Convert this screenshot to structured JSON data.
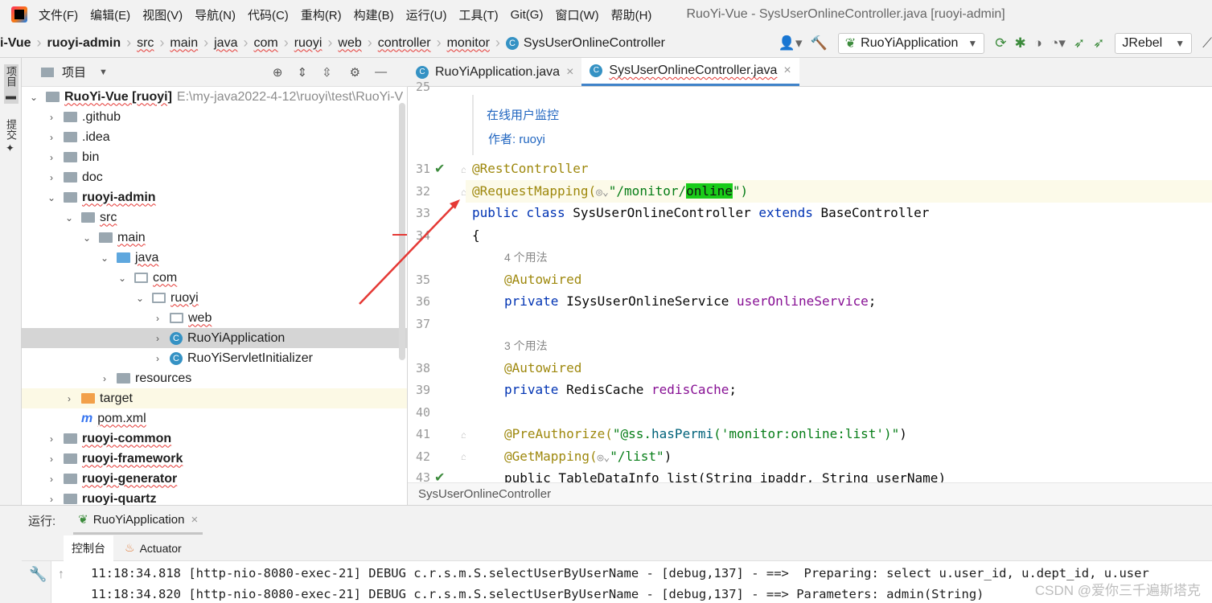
{
  "menubar": {
    "items": [
      "文件(F)",
      "编辑(E)",
      "视图(V)",
      "导航(N)",
      "代码(C)",
      "重构(R)",
      "构建(B)",
      "运行(U)",
      "工具(T)",
      "Git(G)",
      "窗口(W)",
      "帮助(H)"
    ],
    "title": "RuoYi-Vue - SysUserOnlineController.java [ruoyi-admin]"
  },
  "nav": {
    "crumbs": [
      "i-Vue",
      "ruoyi-admin",
      "src",
      "main",
      "java",
      "com",
      "ruoyi",
      "web",
      "controller",
      "monitor",
      "SysUserOnlineController"
    ],
    "run_config": "RuoYiApplication",
    "jrebel": "JRebel"
  },
  "left_tools": {
    "project": "项目",
    "commit": "提交"
  },
  "project": {
    "title": "项目",
    "tree": [
      {
        "label": "RuoYi-Vue [ruoyi]",
        "extra": "E:\\my-java2022-4-12\\ruoyi\\test\\RuoYi-V",
        "chev": "⌄",
        "indent": 0,
        "icon": "module",
        "bold": true
      },
      {
        "label": ".github",
        "chev": "›",
        "indent": 1,
        "icon": "folder"
      },
      {
        "label": ".idea",
        "chev": "›",
        "indent": 1,
        "icon": "folder"
      },
      {
        "label": "bin",
        "chev": "›",
        "indent": 1,
        "icon": "folder"
      },
      {
        "label": "doc",
        "chev": "›",
        "indent": 1,
        "icon": "folder"
      },
      {
        "label": "ruoyi-admin",
        "chev": "⌄",
        "indent": 1,
        "icon": "module",
        "bold": true
      },
      {
        "label": "src",
        "chev": "⌄",
        "indent": 2,
        "icon": "folder"
      },
      {
        "label": "main",
        "chev": "⌄",
        "indent": 3,
        "icon": "folder"
      },
      {
        "label": "java",
        "chev": "⌄",
        "indent": 4,
        "icon": "blue"
      },
      {
        "label": "com",
        "chev": "⌄",
        "indent": 5,
        "icon": "pkg"
      },
      {
        "label": "ruoyi",
        "chev": "⌄",
        "indent": 6,
        "icon": "pkg"
      },
      {
        "label": "web",
        "chev": "›",
        "indent": 7,
        "icon": "pkg"
      },
      {
        "label": "RuoYiApplication",
        "chev": "›",
        "indent": 7,
        "icon": "class",
        "sel": true
      },
      {
        "label": "RuoYiServletInitializer",
        "chev": "›",
        "indent": 7,
        "icon": "class"
      },
      {
        "label": "resources",
        "chev": "›",
        "indent": 4,
        "icon": "folder"
      },
      {
        "label": "target",
        "chev": "›",
        "indent": 2,
        "icon": "orange",
        "yel": true
      },
      {
        "label": "pom.xml",
        "chev": "",
        "indent": 2,
        "icon": "mvn"
      },
      {
        "label": "ruoyi-common",
        "chev": "›",
        "indent": 1,
        "icon": "module",
        "bold": true
      },
      {
        "label": "ruoyi-framework",
        "chev": "›",
        "indent": 1,
        "icon": "module",
        "bold": true
      },
      {
        "label": "ruoyi-generator",
        "chev": "›",
        "indent": 1,
        "icon": "module",
        "bold": true
      },
      {
        "label": "ruoyi-quartz",
        "chev": "›",
        "indent": 1,
        "icon": "module",
        "bold": true
      }
    ]
  },
  "editor": {
    "tabs": [
      {
        "label": "RuoYiApplication.java",
        "close": "×"
      },
      {
        "label": "SysUserOnlineController.java",
        "close": "×"
      }
    ],
    "doc_lines": [
      "在线用户监控",
      "作者: ruoyi"
    ],
    "line_numbers": [
      "25",
      "31",
      "32",
      "33",
      "34",
      "35",
      "36",
      "37",
      "38",
      "39",
      "40",
      "41",
      "42",
      "43"
    ],
    "usage_hints": [
      "4 个用法",
      "3 个用法"
    ],
    "code": {
      "l31": "@RestController",
      "l32_a": "@RequestMapping(",
      "l32_b": "\"/monitor/",
      "l32_c": "online",
      "l32_d": "\")",
      "l33_kw1": "public class ",
      "l33_name": "SysUserOnlineController ",
      "l33_kw2": "extends ",
      "l33_base": "BaseController",
      "l34": "{",
      "l35": "@Autowired",
      "l36_kw": "private ",
      "l36_type": "ISysUserOnlineService ",
      "l36_fld": "userOnlineService",
      "l38": "@Autowired",
      "l39_kw": "private ",
      "l39_type": "RedisCache ",
      "l39_fld": "redisCache",
      "l41_a": "@PreAuthorize(",
      "l41_b": "\"@ss.",
      "l41_c": "hasPermi",
      "l41_d": "('monitor:online:list')\"",
      "l42_a": "@GetMapping(",
      "l42_b": "\"/list\"",
      "l43": "public TableDataInfo list(String ipaddr, String userName)"
    },
    "breadcrumb": "SysUserOnlineController"
  },
  "run": {
    "label": "运行:",
    "tab": "RuoYiApplication",
    "tab_close": "×",
    "subtabs": [
      "控制台",
      "Actuator"
    ],
    "lines": [
      "11:18:34.818 [http-nio-8080-exec-21] DEBUG c.r.s.m.S.selectUserByUserName - [debug,137] - ==>  Preparing: select u.user_id, u.dept_id, u.user",
      "11:18:34.820 [http-nio-8080-exec-21] DEBUG c.r.s.m.S.selectUserByUserName - [debug,137] - ==> Parameters: admin(String)"
    ]
  },
  "watermark": "CSDN @爱你三千遍斯塔克",
  "colors": {
    "accent": "#4083c9",
    "match": "#19cc19",
    "arrow": "#e53935"
  }
}
